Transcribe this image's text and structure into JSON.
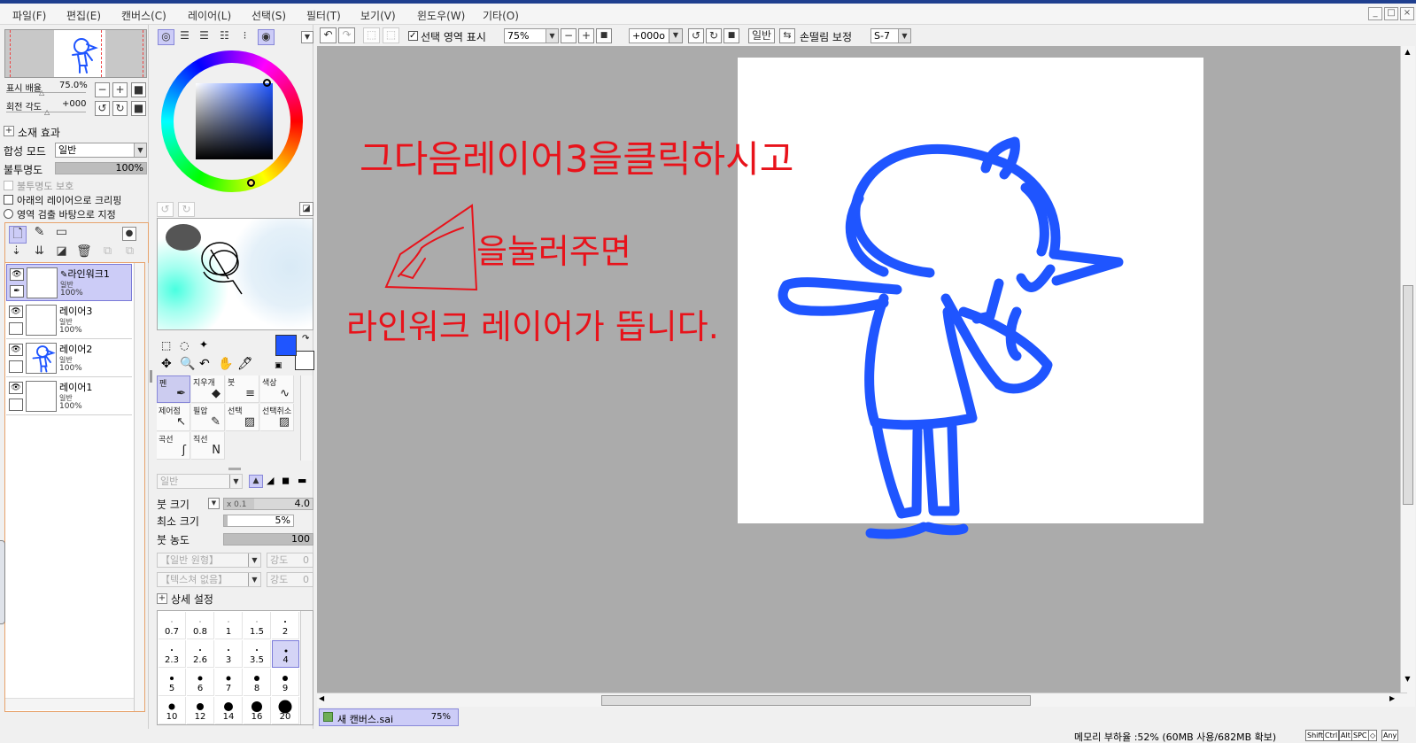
{
  "menu": [
    "파일(F)",
    "편집(E)",
    "캔버스(C)",
    "레이어(L)",
    "선택(S)",
    "필터(T)",
    "보기(V)",
    "윈도우(W)",
    "기타(O)"
  ],
  "window_buttons": [
    "_",
    "□",
    "×"
  ],
  "navigator": {
    "zoom_label": "표시 배율",
    "zoom_value": "75.0%",
    "rotate_label": "회전 각도",
    "rotate_value": "+000"
  },
  "layer_props": {
    "effects_label": "소재 효과",
    "blend_label": "합성 모드",
    "blend_value": "일반",
    "opacity_label": "불투명도",
    "opacity_value": "100%",
    "opacity_fraction": 1.0,
    "protect_opacity": "불투명도 보호",
    "clip_lower": "아래의 레이어으로 크리핑",
    "selection_source": "영역 검출 바탕으로 지정"
  },
  "layers": [
    {
      "name": "라인워크1",
      "mode": "일반",
      "opacity": "100%",
      "selected": true,
      "linework": true
    },
    {
      "name": "레이어3",
      "mode": "일반",
      "opacity": "100%",
      "selected": false,
      "linework": false
    },
    {
      "name": "레이어2",
      "mode": "일반",
      "opacity": "100%",
      "selected": false,
      "linework": false
    },
    {
      "name": "레이어1",
      "mode": "일반",
      "opacity": "100%",
      "selected": false,
      "linework": false
    }
  ],
  "colors": {
    "foreground": "#1f55ff",
    "background": "#ffffff",
    "accent": "#8888d8",
    "stroke_blue": "#1f55ff",
    "annotation_red": "#e8131b"
  },
  "tools": [
    {
      "name": "펜",
      "glyph": "✒",
      "selected": true
    },
    {
      "name": "지우개",
      "glyph": "◆",
      "selected": false
    },
    {
      "name": "붓",
      "glyph": "≡",
      "selected": false
    },
    {
      "name": "색상",
      "glyph": "∿",
      "selected": false
    },
    {
      "name": "제어점",
      "glyph": "↖",
      "selected": false
    },
    {
      "name": "필압",
      "glyph": "✎",
      "selected": false
    },
    {
      "name": "선택",
      "glyph": "▨",
      "selected": false
    },
    {
      "name": "선택취소",
      "glyph": "▨",
      "selected": false
    },
    {
      "name": "곡선",
      "glyph": "ʃ",
      "selected": false
    },
    {
      "name": "직선",
      "glyph": "N",
      "selected": false
    }
  ],
  "brush": {
    "mode_value": "일반",
    "size_label": "붓 크기",
    "size_multiplier": "x 0.1",
    "size_value": "4.0",
    "min_size_label": "최소 크기",
    "min_size_value": "5%",
    "min_size_fraction": 0.05,
    "density_label": "붓 농도",
    "density_value": "100",
    "density_fraction": 1.0,
    "shape_value": "【일반 원형】",
    "texture_value": "【텍스쳐 없음】",
    "strength_label": "강도",
    "strength_value": "0",
    "details_label": "상세 설정"
  },
  "brush_sizes": [
    {
      "label": "0.7",
      "dot": 1,
      "selected": false
    },
    {
      "label": "0.8",
      "dot": 1,
      "selected": false
    },
    {
      "label": "1",
      "dot": 1,
      "selected": false
    },
    {
      "label": "1.5",
      "dot": 1,
      "selected": false
    },
    {
      "label": "2",
      "dot": 2,
      "selected": false
    },
    {
      "label": "2.3",
      "dot": 2,
      "selected": false
    },
    {
      "label": "2.6",
      "dot": 2,
      "selected": false
    },
    {
      "label": "3",
      "dot": 2,
      "selected": false
    },
    {
      "label": "3.5",
      "dot": 2,
      "selected": false
    },
    {
      "label": "4",
      "dot": 3,
      "selected": true
    },
    {
      "label": "5",
      "dot": 4,
      "selected": false
    },
    {
      "label": "6",
      "dot": 5,
      "selected": false
    },
    {
      "label": "7",
      "dot": 5,
      "selected": false
    },
    {
      "label": "8",
      "dot": 6,
      "selected": false
    },
    {
      "label": "9",
      "dot": 6,
      "selected": false
    },
    {
      "label": "10",
      "dot": 7,
      "selected": false
    },
    {
      "label": "12",
      "dot": 8,
      "selected": false
    },
    {
      "label": "14",
      "dot": 10,
      "selected": false
    },
    {
      "label": "16",
      "dot": 12,
      "selected": false
    },
    {
      "label": "20",
      "dot": 15,
      "selected": false
    }
  ],
  "toolbar": {
    "show_selection_label": "선택 영역 표시",
    "zoom_value": "75%",
    "rotation_value": "+000o",
    "blend_value": "일반",
    "stabilizer_label": "손떨림 보정",
    "stabilizer_value": "S-7"
  },
  "annotations": {
    "line1": "그다음레이어3을클릭하시고",
    "line2": "을눌러주면",
    "line3": "라인워크 레이어가 뜹니다."
  },
  "document_tab": {
    "name": "새 캔버스.sai",
    "zoom": "75%"
  },
  "status": {
    "memory": "메모리 부하율 :52% (60MB 사용/682MB 확보)",
    "keys": [
      "Shift",
      "Ctrl",
      "Alt",
      "SPC",
      "◇",
      "Any"
    ]
  }
}
